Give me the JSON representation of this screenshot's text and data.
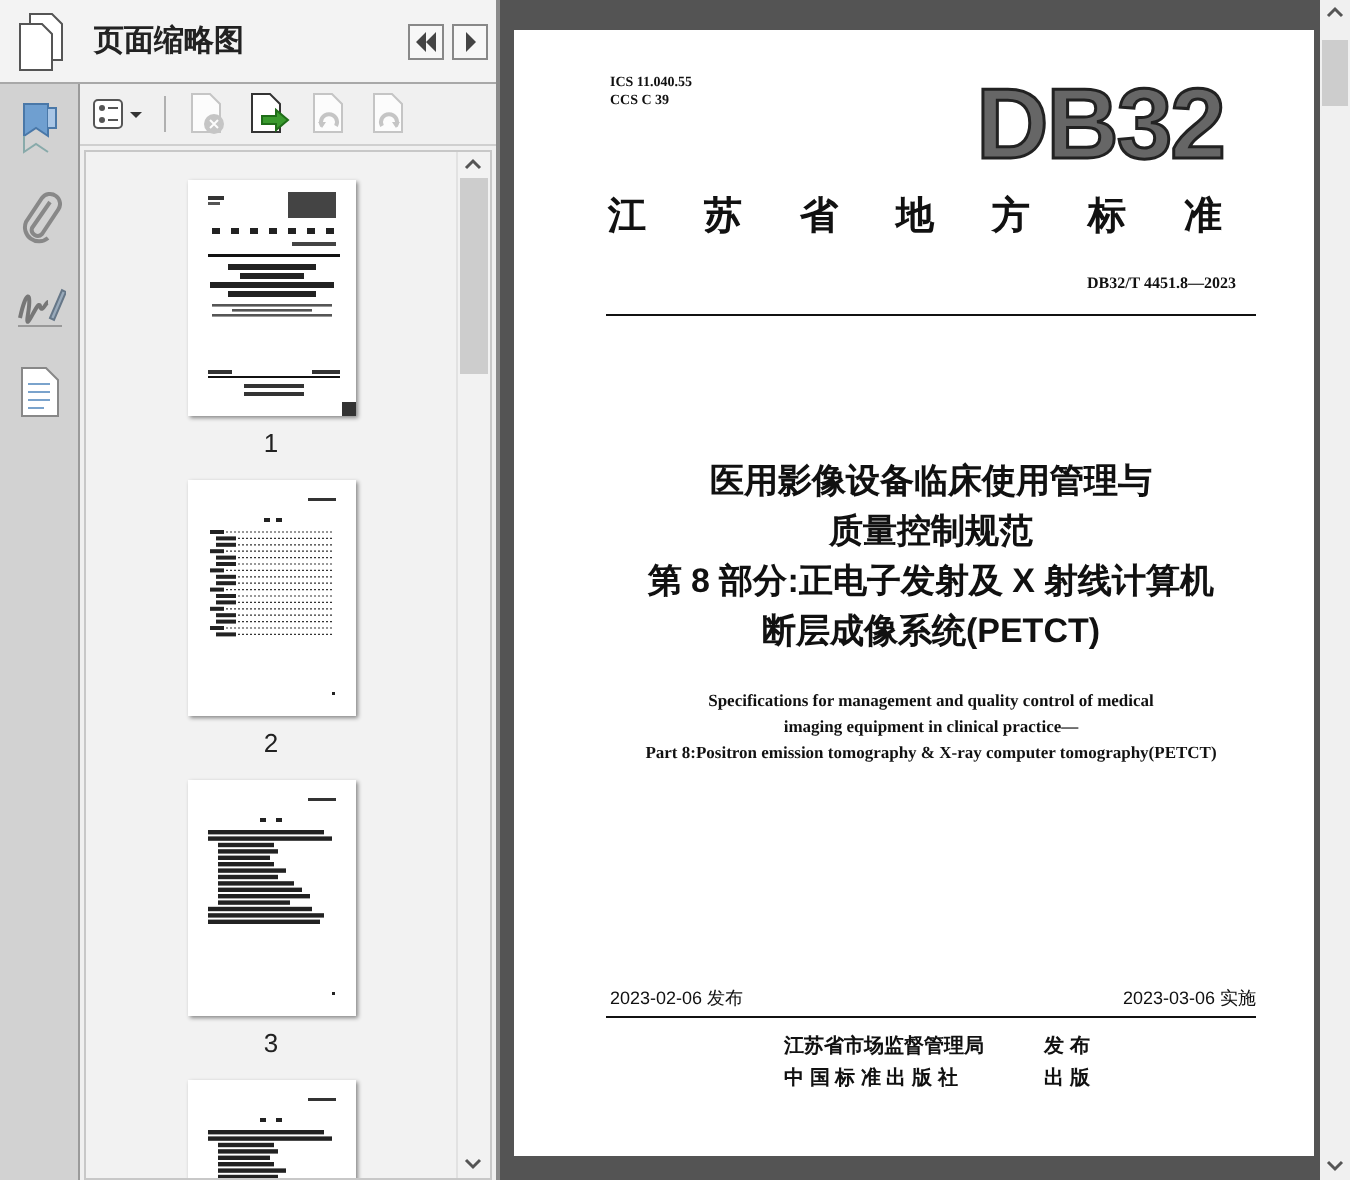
{
  "panel": {
    "title": "页面缩略图",
    "toolbar": [
      {
        "kind": "options",
        "disabled": false
      },
      {
        "kind": "delete",
        "disabled": true
      },
      {
        "kind": "insert",
        "disabled": false
      },
      {
        "kind": "rotate-left",
        "disabled": true
      },
      {
        "kind": "rotate-right",
        "disabled": true
      }
    ],
    "thumbnails": [
      {
        "kind": "cover",
        "label": "1",
        "selected": true
      },
      {
        "kind": "contents",
        "label": "2",
        "selected": false
      },
      {
        "kind": "text",
        "label": "3",
        "selected": false
      },
      {
        "kind": "text"
      }
    ]
  },
  "document": {
    "ics": [
      "ICS 11.040.55",
      "CCS C 39"
    ],
    "logo": "DB32",
    "issuer": "江 苏 省 地 方 标 准",
    "code": "DB32/T 4451.8—2023",
    "title_cn": [
      "医用影像设备临床使用管理与",
      "质量控制规范",
      "第 8 部分:正电子发射及 X 射线计算机",
      "断层成像系统(PETCT)"
    ],
    "title_en": [
      "Specifications for management and quality control of medical",
      "imaging equipment in clinical practice—",
      "Part 8:Positron emission tomography & X-ray computer tomography(PETCT)"
    ],
    "issue_date": "2023-02-06 发布",
    "effective_date": "2023-03-06 实施",
    "publishers": [
      {
        "name": "江苏省市场监督管理局",
        "action": "发 布"
      },
      {
        "name": "中 国 标 准 出 版 社",
        "action": "出 版"
      }
    ]
  }
}
